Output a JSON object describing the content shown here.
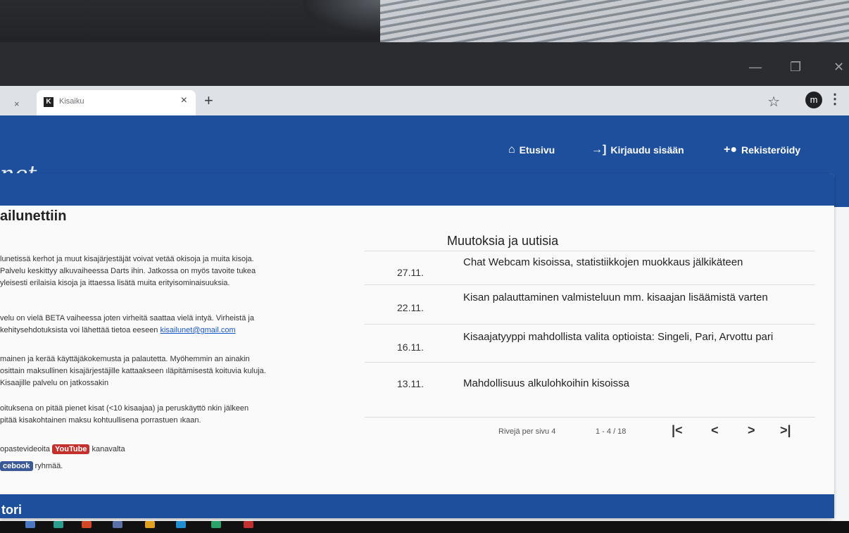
{
  "browser": {
    "tab_title": "Kisaiku",
    "favicon_letter": "K",
    "new_tab": "+",
    "close": "×",
    "avatar_letter": "m",
    "star": "☆",
    "menu": "⋮",
    "win_min": "—",
    "win_max": "❐",
    "win_close": "✕"
  },
  "nav": {
    "brand": "net",
    "home": "Etusivu",
    "login": "Kirjaudu sisään",
    "register": "Rekisteröidy"
  },
  "card": {
    "title": "ailunettiin",
    "intro": {
      "p1": "lunetissä kerhot ja muut kisajärjestäjät voivat vetää okisoja ja muita kisoja. Palvelu keskittyy alkuvaiheessa Darts ihin. Jatkossa on myös tavoite tukea yleisesti erilaisia kisoja ja ittaessa lisätä muita erityisominaisuuksia.",
      "p2_before": "velu on vielä BETA vaiheessa joten virheitä saattaa vielä intyä. Virheistä ja kehitysehdotuksista voi lähettää tietoa eeseen ",
      "email": "kisailunet@gmail.com",
      "p3": "mainen ja kerää käyttäjäkokemusta ja palautetta. Myöhemmin an ainakin osittain maksullinen kisajärjestäjille kattaakseen ıläpitämisestä koituvia kuluja. Kisaajille palvelu on jatkossakin",
      "p4": "oituksena on pitää pienet kisat (<10 kisaajaa) ja peruskäyttö nkin jälkeen pitää kisakohtainen maksu kohtuullisena porrastuen ıkaan.",
      "yt_before": "opastevideoita",
      "yt_badge": "YouTube",
      "yt_after": "kanavalta",
      "fb_badge": "cebook",
      "fb_after": "ryhmää."
    },
    "footer_label": "tori"
  },
  "news": {
    "title": "Muutoksia ja uutisia",
    "items": [
      {
        "date": "27.11.",
        "text": "Chat Webcam kisoissa, statistiikkojen muokkaus jälkikäteen"
      },
      {
        "date": "22.11.",
        "text": "Kisan palauttaminen valmisteluun mm. kisaajan lisäämistä varten"
      },
      {
        "date": "16.11.",
        "text": "Kisaajatyyppi mahdollista valita optioista: Singeli, Pari, Arvottu pari"
      },
      {
        "date": "13.11.",
        "text": "Mahdollisuus alkulohkoihin kisoissa"
      }
    ],
    "pager": {
      "rows_label": "Rivejä per sivu",
      "rows_value": "4",
      "range": "1 - 4 / 18",
      "first": "|<",
      "prev": "<",
      "next": ">",
      "last": ">|"
    }
  },
  "colors": {
    "primary": "#1e4f9c",
    "youtube": "#c4302b",
    "facebook": "#3b5998"
  }
}
